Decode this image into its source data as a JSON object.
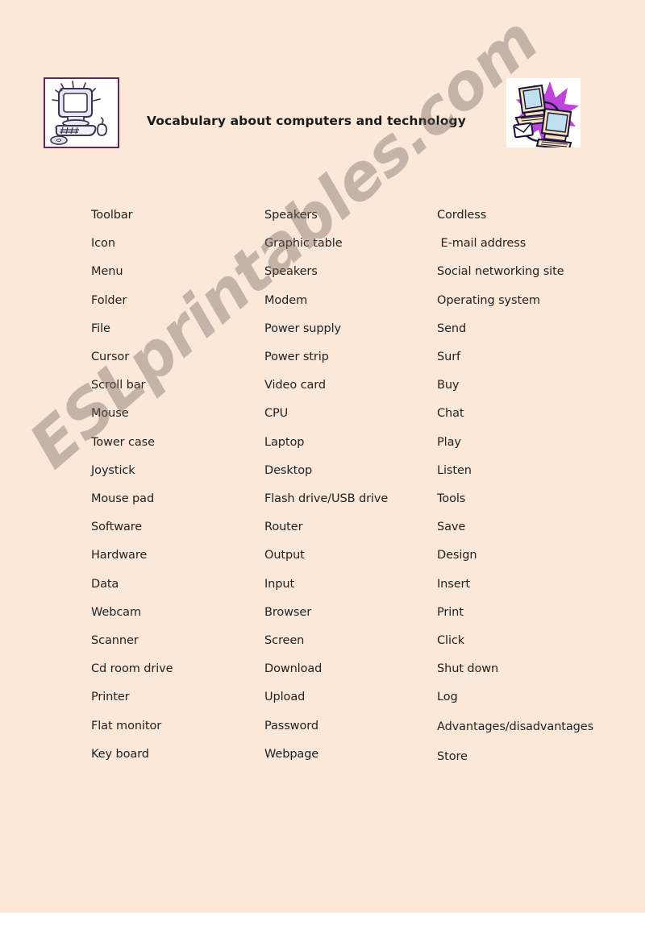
{
  "page": {
    "background_color": "#fbe8d9",
    "outer_background_color": "#ffffff",
    "title": "Vocabulary about computers and technology"
  },
  "header": {
    "title": "Vocabulary about computers and technology",
    "left_image_alt": "desktop-computer-clipart",
    "right_image_alt": "two-networked-computers-clipart",
    "left_image_border_color": "#5b2a5e",
    "right_image_accent_color": "#b43ccf"
  },
  "watermark": {
    "text": "ESLprintables.com",
    "color": "#786860"
  },
  "columns": [
    {
      "name": "column-1",
      "items": [
        "Toolbar",
        "Icon",
        "Menu",
        "Folder",
        "File",
        "Cursor",
        "Scroll bar",
        "Mouse",
        "Tower case",
        "Joystick",
        "Mouse pad",
        "Software",
        "Hardware",
        "Data",
        "Webcam",
        "Scanner",
        "Cd room drive",
        "Printer",
        "Flat monitor",
        "Key board"
      ]
    },
    {
      "name": "column-2",
      "items": [
        "Speakers",
        "Graphic table",
        "Speakers",
        "Modem",
        "Power supply",
        "Power strip",
        "Video card",
        "CPU",
        "Laptop",
        "Desktop",
        "Flash drive/USB drive",
        "Router",
        "Output",
        "Input",
        "Browser",
        "Screen",
        "Download",
        "Upload",
        "Password",
        "Webpage"
      ]
    },
    {
      "name": "column-3",
      "items": [
        "Cordless",
        " E-mail address",
        "Social networking site",
        "Operating system",
        "Send",
        "Surf",
        "Buy",
        "Chat",
        "Play",
        "Listen",
        "Tools",
        "Save",
        "Design",
        "Insert",
        "Print",
        "Click",
        "Shut down",
        "Log",
        "Advantages/disadvantages",
        "Store"
      ]
    }
  ]
}
